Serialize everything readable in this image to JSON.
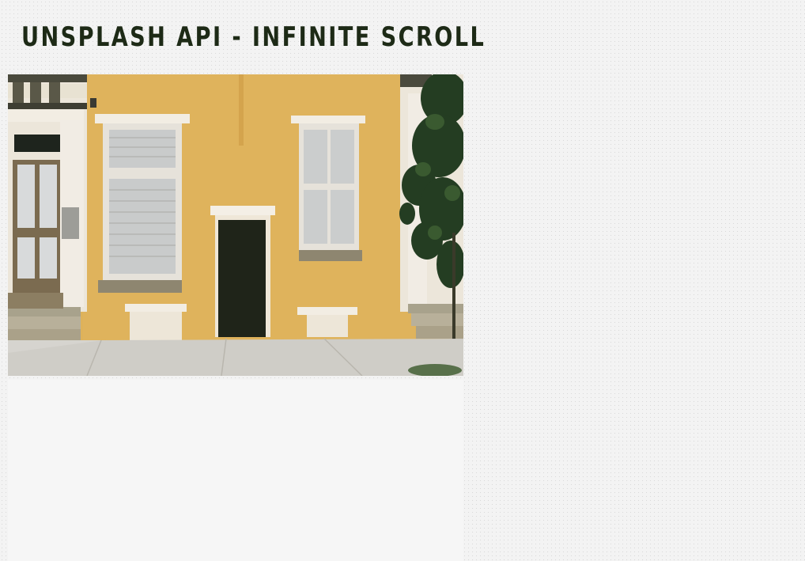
{
  "page": {
    "title": "Unsplash API - Infinite Scroll"
  },
  "feed": {
    "photos": [
      {
        "subject": "yellow-house-facade",
        "colors": {
          "wall": "#deb25a",
          "door": "#1f2419",
          "sidewalk": "#d6d4cf",
          "tree": "#243d22"
        }
      },
      {
        "subject": "loading-placeholder"
      }
    ]
  },
  "colors": {
    "background": "#f3f3f3",
    "title": "#1d2a16"
  }
}
